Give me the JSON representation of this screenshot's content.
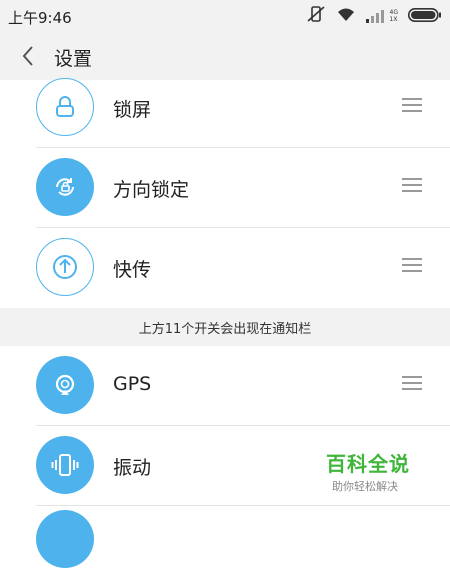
{
  "status_bar": {
    "time": "上午9:46",
    "signal_tiny_top": "4G",
    "signal_tiny_bottom": "1X",
    "icons": [
      "mute-vibrate-icon",
      "wifi-icon",
      "signal-icon",
      "battery-icon"
    ]
  },
  "header": {
    "title": "设置",
    "back_icon": "chevron-left-icon"
  },
  "list_top": [
    {
      "label": "锁屏",
      "icon": "lock-icon",
      "style": "outline"
    },
    {
      "label": "方向锁定",
      "icon": "rotation-lock-icon",
      "style": "filled"
    },
    {
      "label": "快传",
      "icon": "upload-arrow-icon",
      "style": "outline"
    }
  ],
  "section_note": "上方11个开关会出现在通知栏",
  "list_bottom": [
    {
      "label": "GPS",
      "icon": "location-icon",
      "style": "filled"
    },
    {
      "label": "振动",
      "icon": "vibrate-icon",
      "style": "filled"
    }
  ],
  "watermark": {
    "title": "百科全说",
    "subtitle": "助你轻松解决"
  },
  "colors": {
    "accent": "#4eb3ec",
    "watermark_green": "#3fb53a"
  }
}
